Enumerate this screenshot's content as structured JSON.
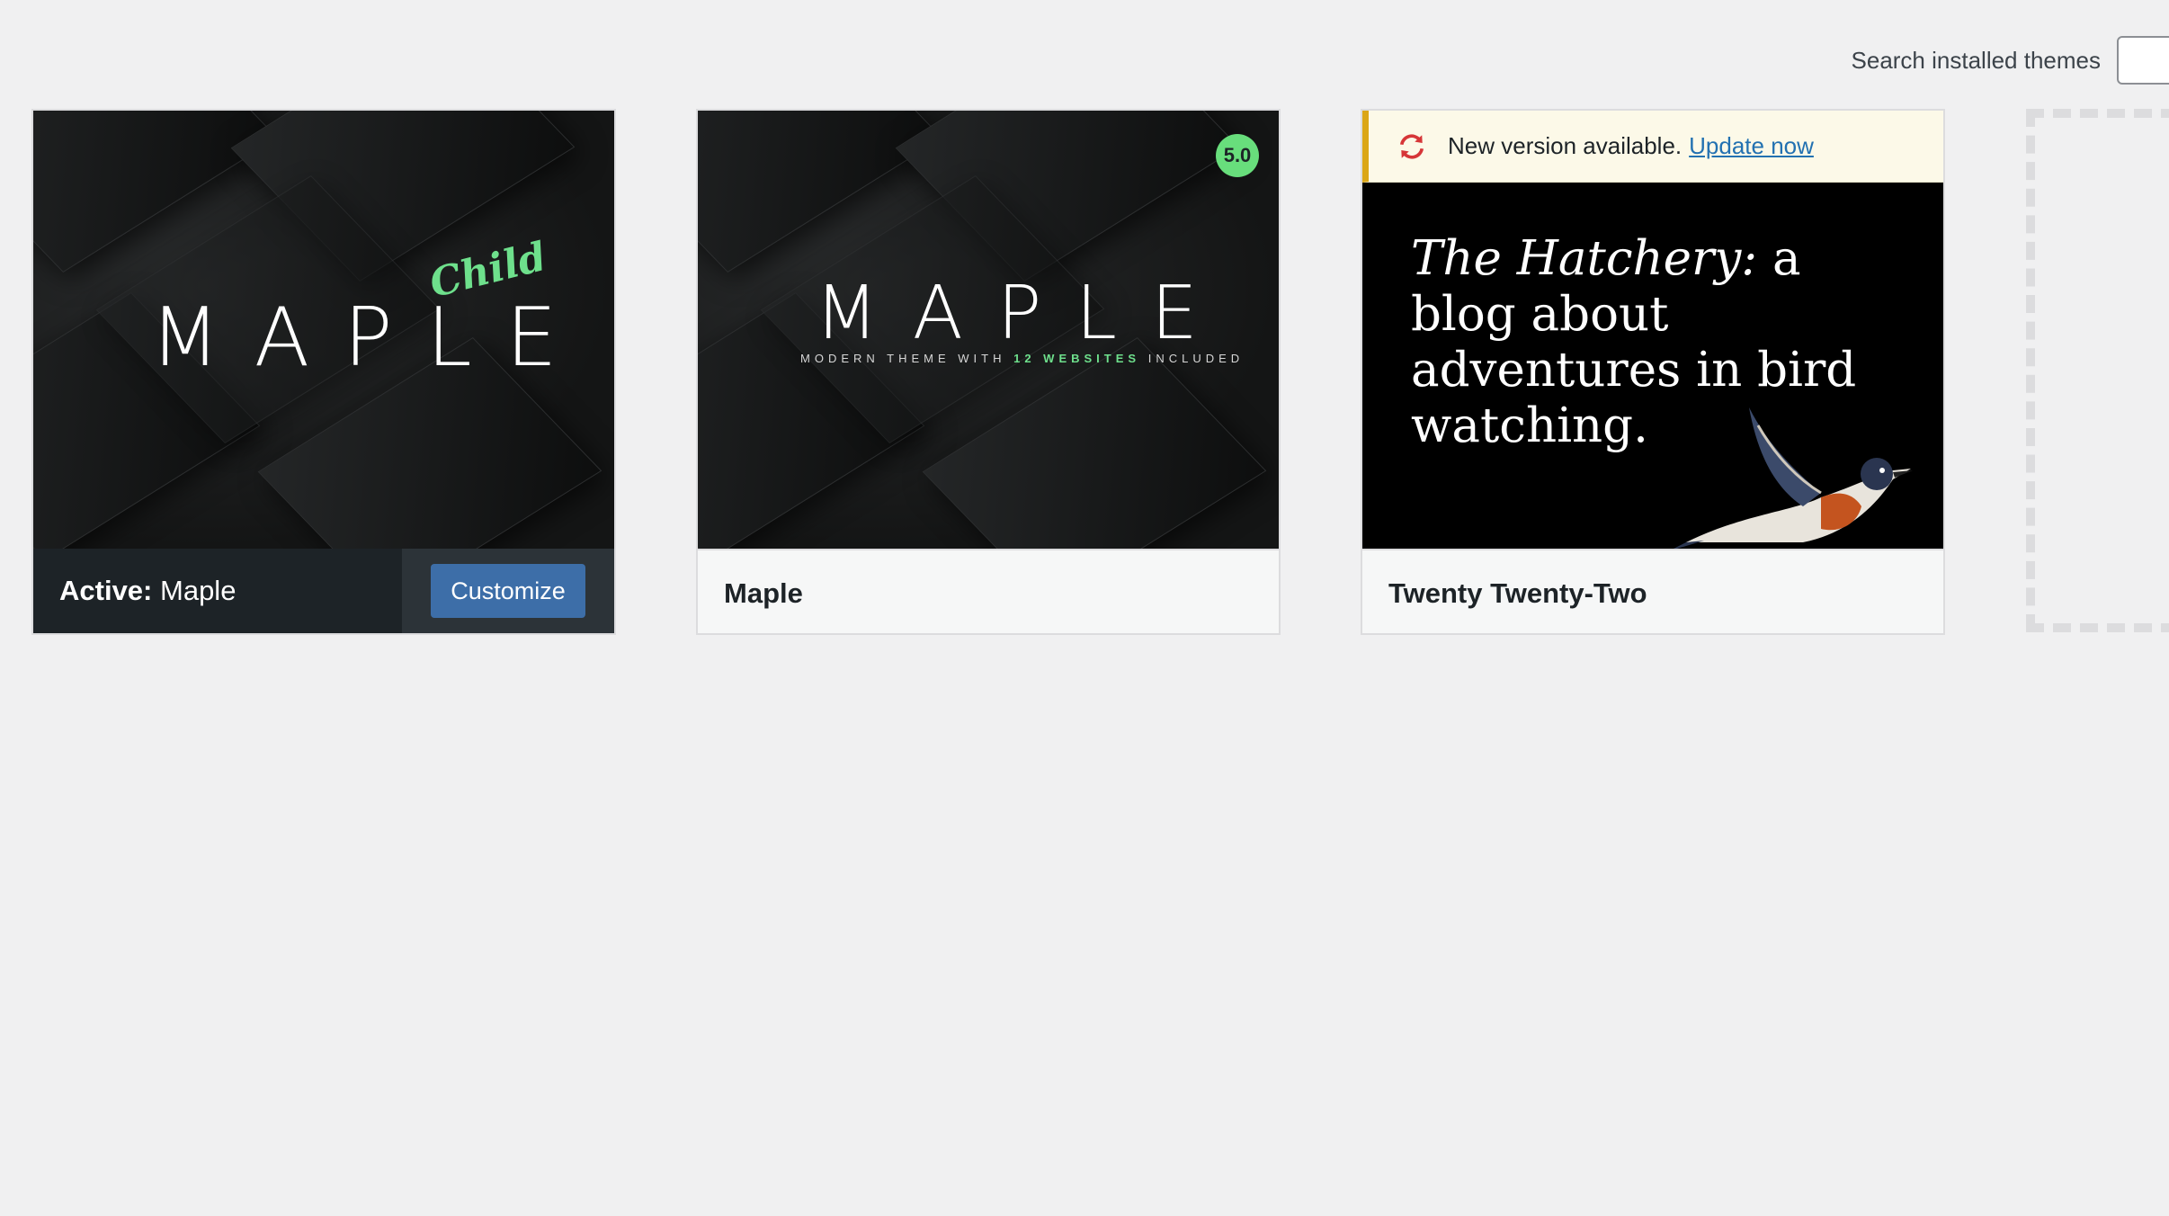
{
  "search": {
    "label": "Search installed themes",
    "placeholder": "",
    "value": ""
  },
  "themes": [
    {
      "name": "Maple",
      "active": true,
      "active_prefix": "Active:",
      "screenshot": {
        "logo_text": "MAPLE",
        "badge_text": "Child"
      },
      "actions": {
        "customize_label": "Customize"
      }
    },
    {
      "name": "Maple",
      "active": false,
      "screenshot": {
        "logo_text": "MAPLE",
        "tagline_before": "MODERN THEME WITH",
        "tagline_highlight": "12 WEBSITES",
        "tagline_after": "INCLUDED"
      },
      "version_badge": "5.0"
    },
    {
      "name": "Twenty Twenty-Two",
      "active": false,
      "update_notice": {
        "text": "New version available.",
        "link_label": "Update now",
        "icon": "update-sync-icon"
      },
      "screenshot": {
        "headline_italic": "The Hatchery:",
        "headline_rest": " a blog about adventures in bird watching.",
        "image": "swallow-bird-illustration"
      }
    }
  ],
  "add_new_theme": {
    "icon": "add-theme-placeholder"
  },
  "colors": {
    "background": "#f0f0f1",
    "active_bar": "#1d2327",
    "button": "#3d6ea8",
    "accent_green": "#68de7c",
    "notice_border": "#dba617",
    "link": "#2271b1"
  }
}
